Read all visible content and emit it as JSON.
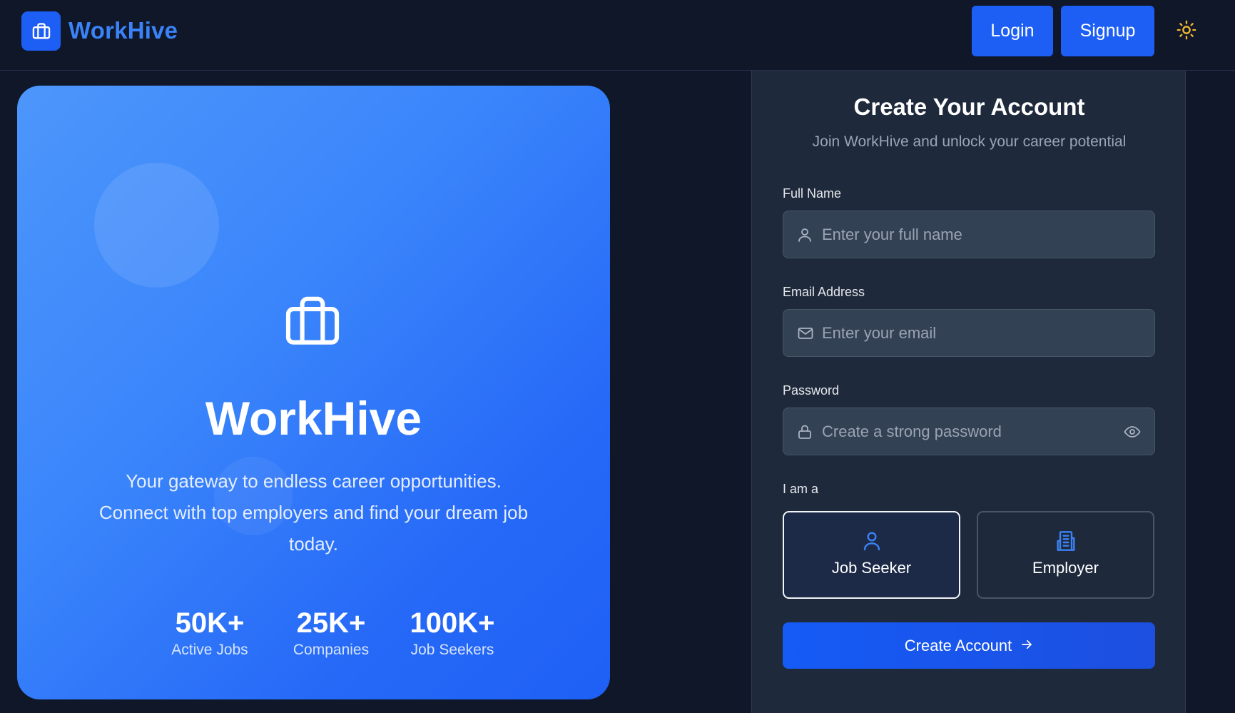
{
  "nav": {
    "brand": "WorkHive",
    "login_label": "Login",
    "signup_label": "Signup",
    "logo_icon": "briefcase-icon",
    "theme_icon": "sun-icon"
  },
  "hero": {
    "title": "WorkHive",
    "description": "Your gateway to endless career opportunities. Connect with top employers and find your dream job today.",
    "icon": "briefcase-icon",
    "stats": [
      {
        "value": "50K+",
        "label": "Active Jobs"
      },
      {
        "value": "25K+",
        "label": "Companies"
      },
      {
        "value": "100K+",
        "label": "Job Seekers"
      }
    ]
  },
  "form": {
    "title": "Create Your Account",
    "subtitle": "Join WorkHive and unlock your career potential",
    "fields": {
      "full_name": {
        "label": "Full Name",
        "placeholder": "Enter your full name",
        "value": "",
        "icon": "user-icon"
      },
      "email": {
        "label": "Email Address",
        "placeholder": "Enter your email",
        "value": "",
        "icon": "mail-icon"
      },
      "password": {
        "label": "Password",
        "placeholder": "Create a strong password",
        "value": "",
        "icon": "lock-icon"
      }
    },
    "role_label": "I am a",
    "roles": [
      {
        "label": "Job Seeker",
        "icon": "user-icon",
        "selected": true
      },
      {
        "label": "Employer",
        "icon": "building-icon",
        "selected": false
      }
    ],
    "submit_label": "Create Account"
  },
  "colors": {
    "background": "#0f1729",
    "accent": "#1d5ff5",
    "brand_text": "#3b82f6",
    "panel": "#1e293b",
    "input": "#334155",
    "sun": "#f5b731"
  }
}
